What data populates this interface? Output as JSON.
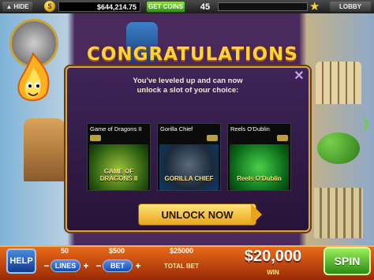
{
  "topbar": {
    "hide_label": "HIDE",
    "coin_symbol": "$",
    "coin_balance": "$644,214.75",
    "get_coins_label": "GET COINS",
    "level": "45",
    "xp_progress": 0.0,
    "lobby_label": "LOBBY"
  },
  "dialog": {
    "title": "CONGRATULATIONS",
    "message_line1": "You've leveled up and can now",
    "message_line2": "unlock a slot of your choice:",
    "slots": [
      {
        "label": "Game of Dragons II",
        "art_text": "GAME OF DRAGONS II"
      },
      {
        "label": "Gorilla Chief",
        "art_text": "GORILLA CHIEF"
      },
      {
        "label": "Reels O'Dublin",
        "art_text": "Reels O'Dublin"
      }
    ],
    "unlock_label": "UNLOCK NOW"
  },
  "bottombar": {
    "help_label": "HELP",
    "lines_value": "50",
    "lines_label": "LINES",
    "bet_value": "$500",
    "bet_label": "BET",
    "total_bet_value": "$25000",
    "total_bet_label": "TOTAL BET",
    "win_value": "$20,000",
    "win_label": "WIN",
    "spin_label": "SPIN"
  },
  "colors": {
    "accent_gold": "#ffd23a",
    "dialog_bg": "#3e2458",
    "spin_green": "#2a8a12",
    "bottom_orange": "#e86a1a"
  }
}
